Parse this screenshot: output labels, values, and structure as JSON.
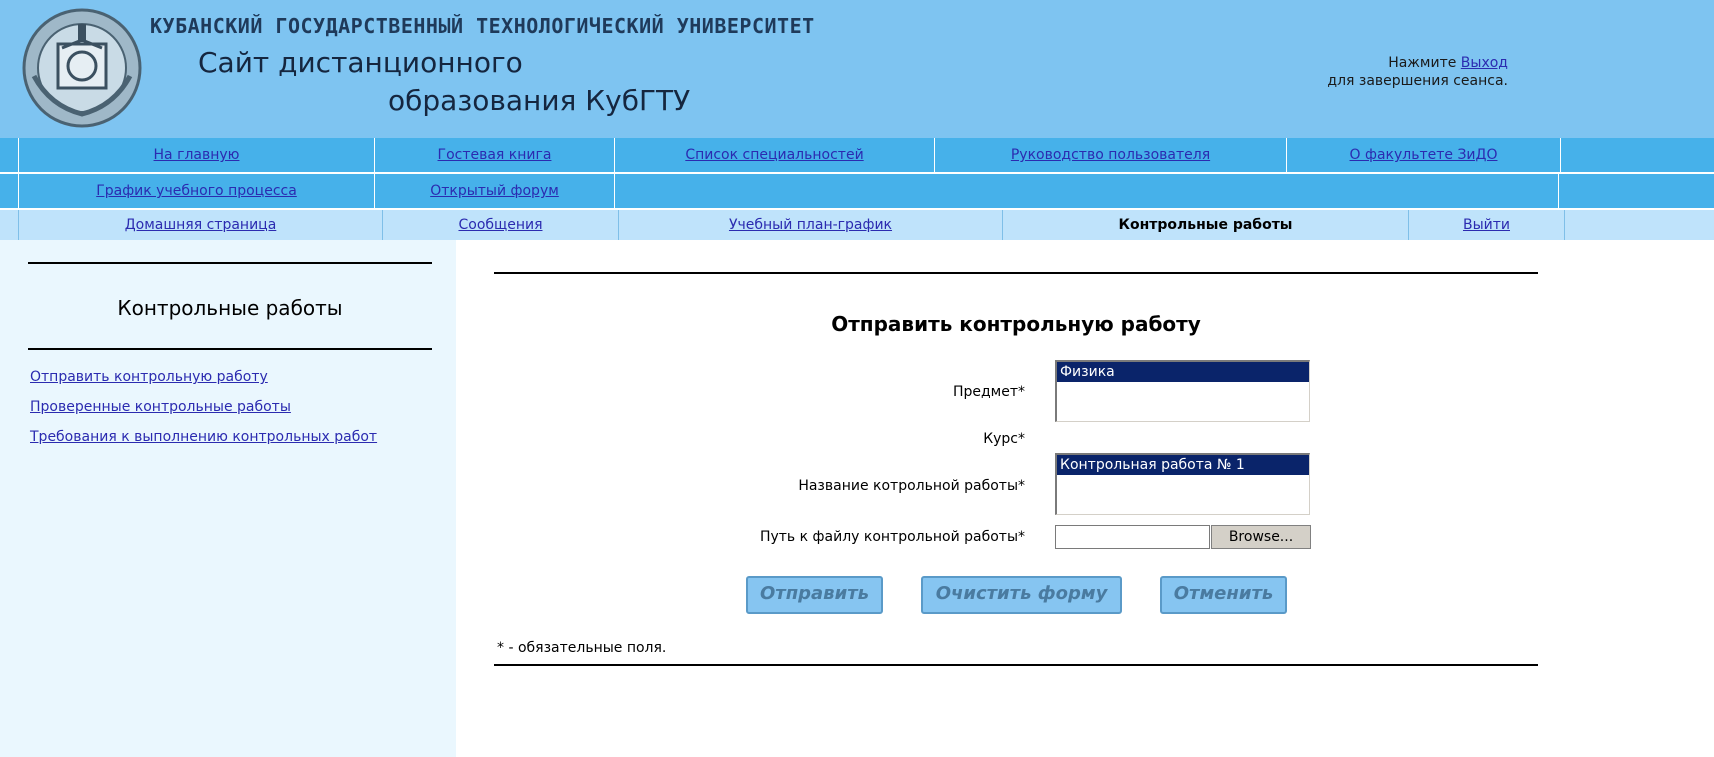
{
  "header": {
    "university": "КУБАНСКИЙ ГОСУДАРСТВЕННЫЙ ТЕХНОЛОГИЧЕСКИЙ УНИВЕРСИТЕТ",
    "site_line1": "Сайт дистанционного",
    "site_line2": "образования КубГТУ",
    "session_prefix": "Нажмите ",
    "session_link": "Выход",
    "session_suffix": "для завершения сеанса."
  },
  "nav_top": [
    "На главную",
    "Гостевая книга",
    "Список специальностей",
    "Руководство пользователя",
    "О факультете ЗиДО"
  ],
  "nav_second": [
    "График учебного процесса",
    "Открытый форум"
  ],
  "nav_user": {
    "home": "Домашняя страница",
    "messages": "Сообщения",
    "plan": "Учебный план-график",
    "active": "Контрольные работы",
    "logout": "Выйти"
  },
  "sidebar": {
    "title": "Контрольные работы",
    "links": [
      "Отправить контрольную работу",
      "Проверенные контрольные работы",
      "Требования к выполнению контрольных работ"
    ]
  },
  "form": {
    "title": "Отправить контрольную работу",
    "subject_label": "Предмет*",
    "subject_selected": "Физика",
    "course_label": "Курс*",
    "work_label": "Название котрольной работы*",
    "work_selected": "Контрольная работа № 1",
    "file_label": "Путь к файлу контрольной работы*",
    "browse_label": "Browse...",
    "submit": "Отправить",
    "clear": "Очистить форму",
    "cancel": "Отменить",
    "required_note": "* - обязательные поля."
  },
  "colors": {
    "header_bg": "#7ec4f1",
    "nav_bg": "#46b1ea",
    "nav_user_bg": "#bfe3fb",
    "sidebar_bg": "#eaf7fe",
    "selection": "#0a246a"
  }
}
